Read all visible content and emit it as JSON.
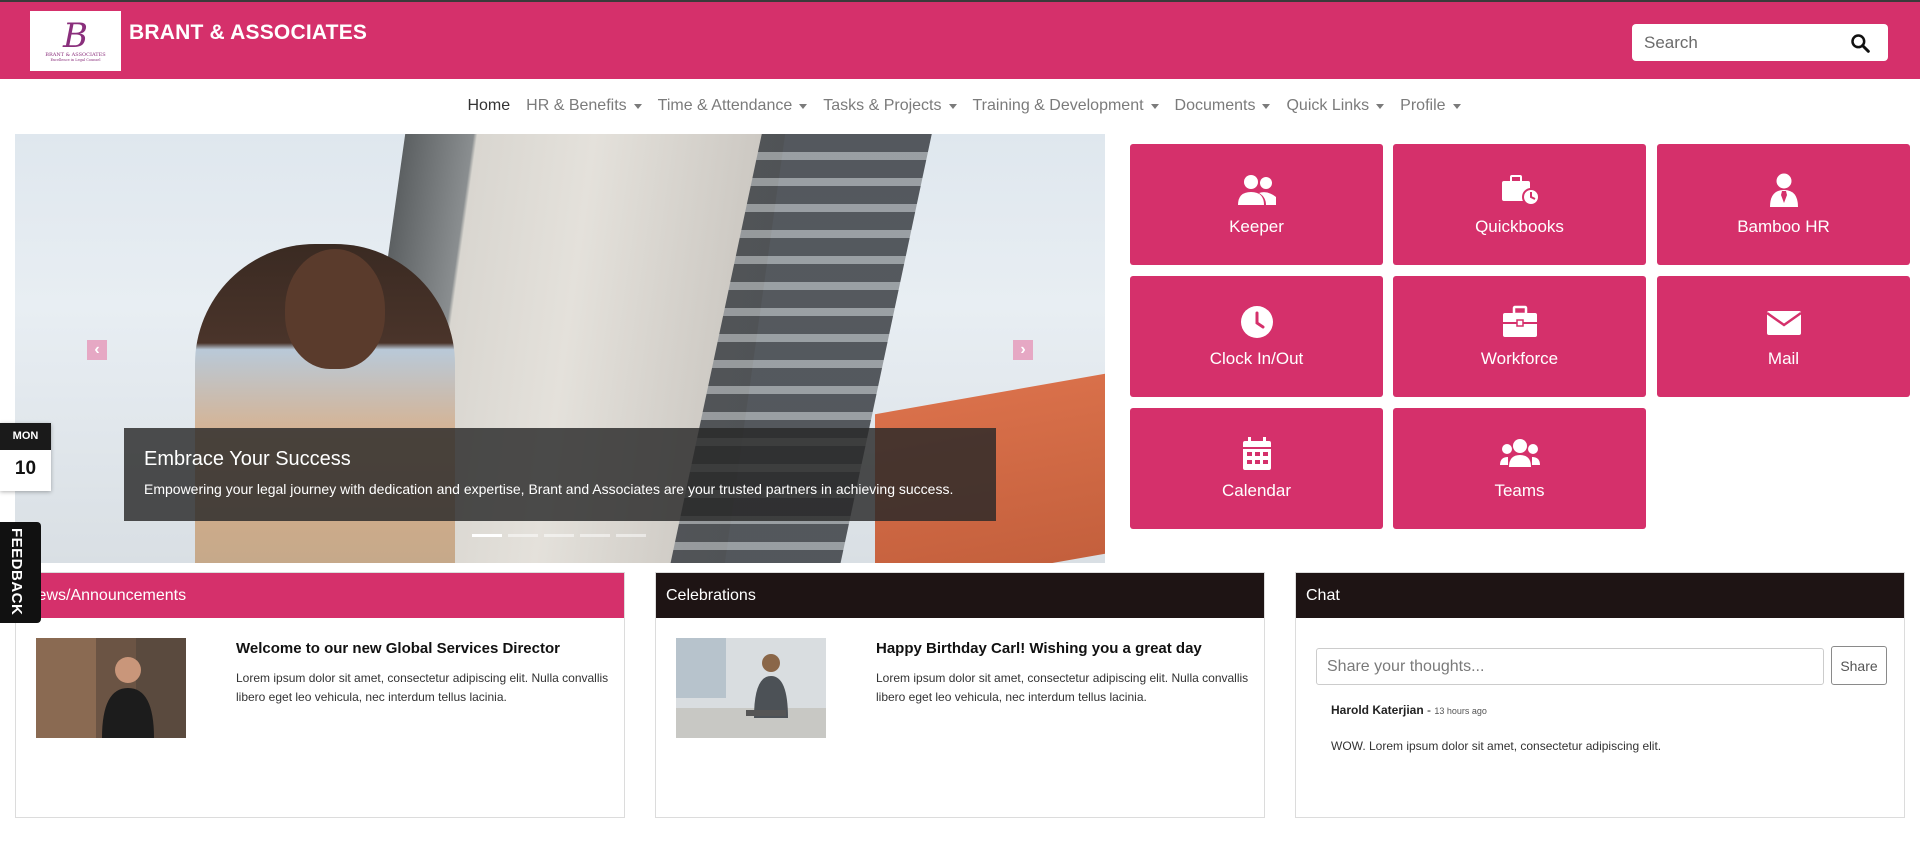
{
  "header": {
    "brand": "BRANT & ASSOCIATES",
    "logo_letter": "B",
    "logo_text": "BRANT & ASSOCIATES",
    "logo_tagline": "Excellence in Legal Counsel",
    "search_placeholder": "Search",
    "accent_color": "#d5306b"
  },
  "nav": {
    "items": [
      {
        "label": "Home",
        "dropdown": false
      },
      {
        "label": "HR & Benefits",
        "dropdown": true
      },
      {
        "label": "Time & Attendance",
        "dropdown": true
      },
      {
        "label": "Tasks & Projects",
        "dropdown": true
      },
      {
        "label": "Training & Development",
        "dropdown": true
      },
      {
        "label": "Documents",
        "dropdown": true
      },
      {
        "label": "Quick Links",
        "dropdown": true
      },
      {
        "label": "Profile",
        "dropdown": true
      }
    ]
  },
  "hero": {
    "title": "Embrace Your Success",
    "text": "Empowering your legal journey with dedication and expertise, Brant and Associates are your trusted partners in achieving success.",
    "prev_icon": "chevron-left-icon",
    "next_icon": "chevron-right-icon",
    "slides": 5,
    "active_slide": 1
  },
  "tiles": [
    {
      "label": "Keeper",
      "icon": "users-icon"
    },
    {
      "label": "Quickbooks",
      "icon": "briefcase-clock-icon"
    },
    {
      "label": "Bamboo HR",
      "icon": "user-tie-icon"
    },
    {
      "label": "Clock In/Out",
      "icon": "clock-icon"
    },
    {
      "label": "Workforce",
      "icon": "briefcase-icon"
    },
    {
      "label": "Mail",
      "icon": "envelope-icon"
    },
    {
      "label": "Calendar",
      "icon": "calendar-icon"
    },
    {
      "label": "Teams",
      "icon": "team-icon"
    }
  ],
  "date_widget": {
    "day": "MON",
    "date": "10"
  },
  "feedback_label": "FEEDBACK",
  "news": {
    "title": "News/Announcements",
    "item_title": "Welcome to our new Global Services Director",
    "item_body": "Lorem ipsum dolor sit amet, consectetur adipiscing elit. Nulla convallis libero eget leo vehicula, nec interdum tellus lacinia."
  },
  "celebrations": {
    "title": "Celebrations",
    "item_title": "Happy Birthday Carl! Wishing you a great day",
    "item_body": "Lorem ipsum dolor sit amet, consectetur adipiscing elit. Nulla convallis libero eget leo vehicula, nec interdum tellus lacinia."
  },
  "chat": {
    "title": "Chat",
    "input_placeholder": "Share your thoughts...",
    "share_label": "Share",
    "author": "Harold Katerjian",
    "separator": " - ",
    "time": "13 hours ago",
    "message": "WOW. Lorem ipsum dolor sit amet, consectetur adipiscing elit."
  },
  "colors": {
    "accent": "#d5306b",
    "dark_header": "#1e1414"
  }
}
